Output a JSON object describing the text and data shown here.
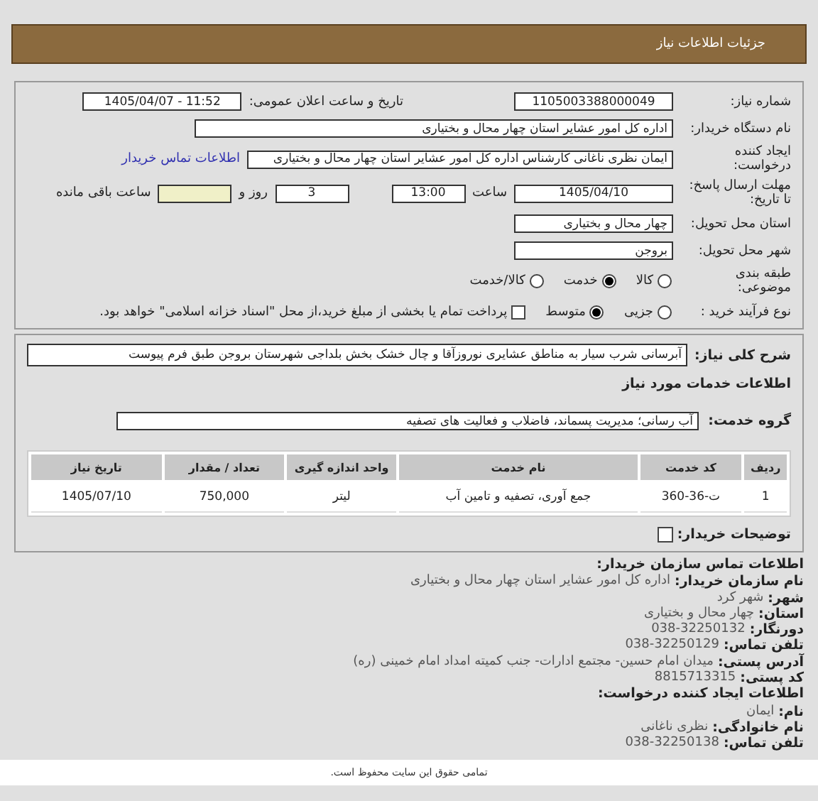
{
  "header": {
    "title": "جزئیات اطلاعات نیاز"
  },
  "need_number": {
    "label": "شماره نیاز:",
    "value": "1105003388000049"
  },
  "announce": {
    "label": "تاریخ و ساعت اعلان عمومی:",
    "value": "1405/04/07 - 11:52"
  },
  "buyer": {
    "label": "نام دستگاه خریدار:",
    "value": "اداره کل امور عشایر استان چهار محال و بختیاری"
  },
  "creator": {
    "label": "ایجاد کننده درخواست:",
    "value": "ایمان نظری ناغانی کارشناس اداره کل امور عشایر استان چهار محال و بختیاری",
    "link": "اطلاعات تماس خریدار"
  },
  "deadline": {
    "label": "مهلت ارسال پاسخ: تا تاریخ:",
    "date": "1405/04/10",
    "time_label": "ساعت",
    "time": "13:00",
    "days": "3",
    "days_label": "روز و",
    "hours_label": "ساعت باقی مانده"
  },
  "province": {
    "label": "استان محل تحویل:",
    "value": "چهار محال و بختیاری"
  },
  "city": {
    "label": "شهر محل تحویل:",
    "value": "بروجن"
  },
  "category": {
    "label": "طبقه بندی موضوعی:",
    "options": [
      {
        "label": "کالا",
        "selected": false
      },
      {
        "label": "خدمت",
        "selected": true
      },
      {
        "label": "کالا/خدمت",
        "selected": false
      }
    ]
  },
  "process": {
    "label": "نوع فرآیند خرید :",
    "options": [
      {
        "label": "جزیی",
        "selected": false
      },
      {
        "label": "متوسط",
        "selected": true
      }
    ],
    "payment": {
      "checked": false,
      "label": "پرداخت تمام یا بخشی از مبلغ خرید،از محل \"اسناد خزانه اسلامی\" خواهد بود."
    }
  },
  "summary": {
    "label": "شرح کلی نیاز:",
    "value": "آبرسانی شرب سیار به مناطق عشایری نوروزآقا و چال خشک بخش بلداجی شهرستان بروجن طبق فرم پیوست"
  },
  "services_heading": "اطلاعات خدمات مورد نیاز",
  "service_group": {
    "label": "گروه خدمت:",
    "value": "آب رسانی؛ مدیریت پسماند، فاضلاب و فعالیت های تصفیه"
  },
  "table": {
    "columns": [
      "ردیف",
      "کد خدمت",
      "نام خدمت",
      "واحد اندازه گیری",
      "تعداد / مقدار",
      "تاریخ نیاز"
    ],
    "rows": [
      [
        "1",
        "ت-36-360",
        "جمع آوری، تصفیه و تامین آب",
        "لیتر",
        "750,000",
        "1405/07/10"
      ]
    ]
  },
  "buyer_notes": {
    "label": "توضیحات خریدار:",
    "checked": false
  },
  "contact": [
    {
      "kind": "heading",
      "label": "اطلاعات تماس سازمان خریدار:"
    },
    {
      "kind": "pair",
      "label": "نام سازمان خریدار:",
      "value": "اداره کل امور عشایر استان چهار محال و بختیاری"
    },
    {
      "kind": "pair",
      "label": "شهر:",
      "value": "شهر کرد"
    },
    {
      "kind": "pair",
      "label": "استان:",
      "value": "چهار محال و بختیاری"
    },
    {
      "kind": "pair",
      "label": "دورنگار:",
      "value": "038-32250132"
    },
    {
      "kind": "pair",
      "label": "تلفن تماس:",
      "value": "038-32250129"
    },
    {
      "kind": "pair",
      "label": "آدرس پستی:",
      "value": "میدان امام حسین- مجتمع ادارات- جنب کمیته امداد امام خمینی (ره)"
    },
    {
      "kind": "pair",
      "label": "کد پستی:",
      "value": "8815713315"
    },
    {
      "kind": "heading",
      "label": "اطلاعات ایجاد کننده درخواست:"
    },
    {
      "kind": "pair",
      "label": "نام:",
      "value": "ایمان"
    },
    {
      "kind": "pair",
      "label": "نام خانوادگی:",
      "value": "نظری ناغانی"
    },
    {
      "kind": "pair",
      "label": "تلفن تماس:",
      "value": "038-32250138"
    }
  ],
  "footer": "تمامی حقوق این سایت محفوظ است."
}
